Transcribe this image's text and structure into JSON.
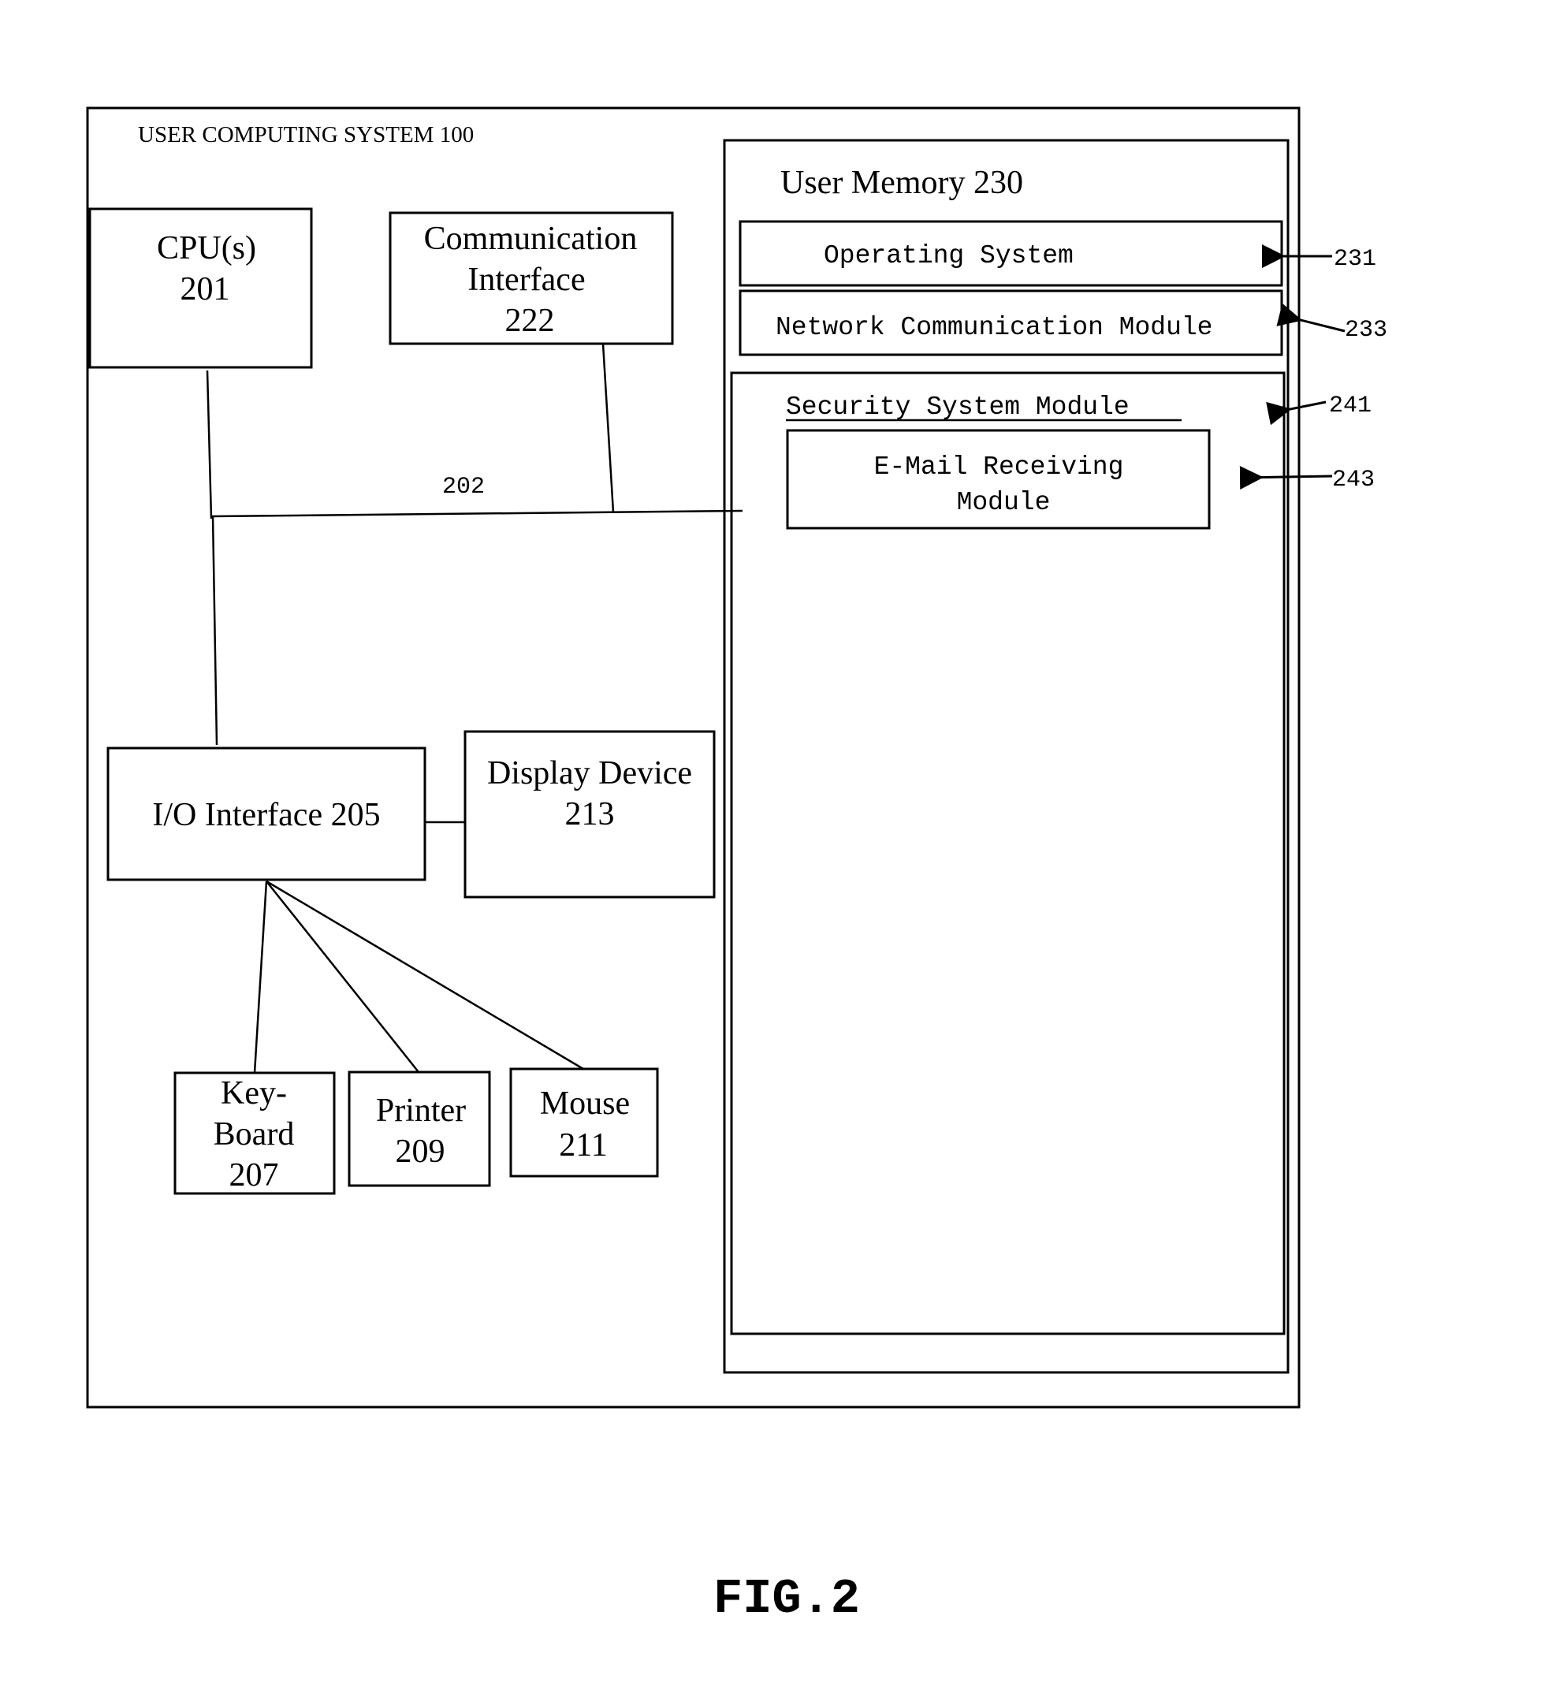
{
  "figure": {
    "caption": "FIG.2",
    "system_title": "USER COMPUTING SYSTEM 100",
    "bus_label": "202",
    "cpu": {
      "line1": "CPU(s)",
      "line2": "201"
    },
    "comm_interface": {
      "line1": "Communication",
      "line2": "Interface",
      "line3": "222"
    },
    "io_interface": {
      "label": "I/O Interface 205"
    },
    "display": {
      "line1": "Display Device",
      "line2": "213"
    },
    "keyboard": {
      "line1": "Key-",
      "line2": "Board",
      "line3": "207"
    },
    "printer": {
      "line1": "Printer",
      "line2": "209"
    },
    "mouse": {
      "line1": "Mouse",
      "line2": "211"
    },
    "user_memory": {
      "title": "User Memory 230",
      "operating_system": "Operating System",
      "network_module": "Network Communication Module",
      "security_module": "Security System Module",
      "email_module": {
        "line1": "E-Mail Receiving",
        "line2": "Module"
      }
    },
    "reference_numerals": {
      "os": "231",
      "network": "233",
      "security": "241",
      "email": "243"
    }
  }
}
